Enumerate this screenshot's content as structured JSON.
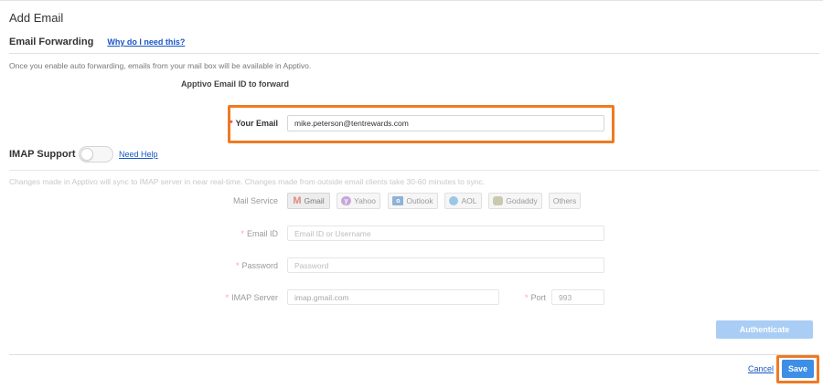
{
  "page": {
    "title": "Add Email"
  },
  "forwarding": {
    "section_title": "Email Forwarding",
    "help_link": "Why do I need this?",
    "description": "Once you enable auto forwarding, emails from your mail box will be available in Apptivo.",
    "apptivo_label": "Apptivo Email ID to forward",
    "your_email_label": "Your Email",
    "your_email_value": "mike.peterson@tentrewards.com",
    "required_mark": "*"
  },
  "imap": {
    "section_title": "IMAP Support",
    "enabled": false,
    "help_link": "Need Help",
    "description": "Changes made in Apptivo will sync to IMAP server in near real-time. Changes made from outside email clients take 30-60 minutes to sync.",
    "mail_service_label": "Mail Service",
    "services": [
      {
        "label": "Gmail",
        "icon": "gmail-icon",
        "active": true
      },
      {
        "label": "Yahoo",
        "icon": "yahoo-icon",
        "active": false
      },
      {
        "label": "Outlook",
        "icon": "outlook-icon",
        "active": false
      },
      {
        "label": "AOL",
        "icon": "aol-icon",
        "active": false
      },
      {
        "label": "Godaddy",
        "icon": "godaddy-icon",
        "active": false
      },
      {
        "label": "Others",
        "icon": "",
        "active": false
      }
    ],
    "email_id_label": "Email ID",
    "email_id_placeholder": "Email ID or Username",
    "password_label": "Password",
    "password_placeholder": "Password",
    "server_label": "IMAP Server",
    "server_value": "imap.gmail.com",
    "port_label": "Port",
    "port_value": "993",
    "authenticate_label": "Authenticate"
  },
  "footer": {
    "cancel_label": "Cancel",
    "save_label": "Save"
  },
  "colors": {
    "highlight": "#ef7a22",
    "link": "#1a55c7",
    "primary": "#3d8ee6",
    "primary_disabled": "#a9cdf4",
    "required": "#e0412a"
  }
}
